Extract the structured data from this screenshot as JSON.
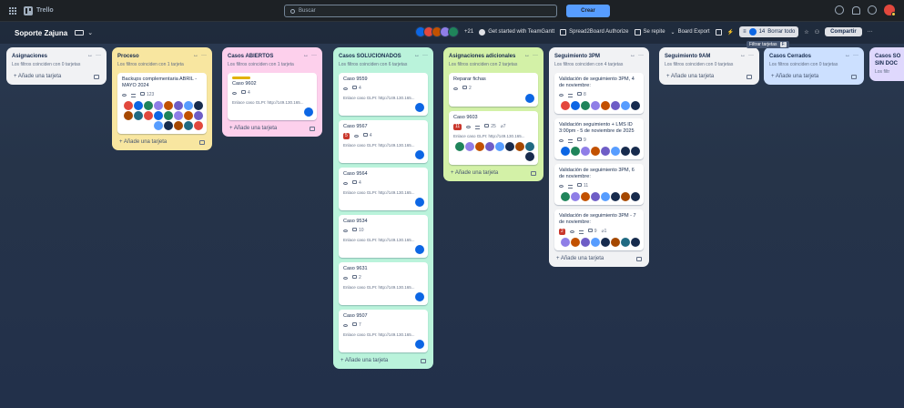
{
  "topbar": {
    "app_name": "Trello",
    "search_placeholder": "Buscar",
    "create_label": "Crear"
  },
  "board": {
    "name": "Soporte Zajuna",
    "members_extra": "+21",
    "get_started": "Get started with TeamGantt",
    "spread2board": "Spread2Board Authorize",
    "se_repite": "Se repite",
    "board_export": "Board Export",
    "filter_count": "14",
    "clear_all": "Borrar todo",
    "share": "Compartir",
    "filter_tooltip": "Filtrar tarjetas",
    "filter_tooltip_key": "F"
  },
  "add_card_label": "Añade una tarjeta",
  "lists": [
    {
      "title": "Asignaciones",
      "sub": "Los filtros coinciden con 0 tarjetas",
      "color": "#f1f2f4",
      "cards": []
    },
    {
      "title": "Proceso",
      "sub": "Los filtros coinciden con 1 tarjeta",
      "color": "#f8e6a0",
      "cards": [
        {
          "title": "Backups complementaria ABRIL - MAYO 2024",
          "comments": "123"
        }
      ]
    },
    {
      "title": "Casos ABIERTOS",
      "sub": "Los filtros coinciden con 1 tarjeta",
      "color": "#fdd0ec",
      "cards": [
        {
          "title": "Caso 9602",
          "comments": "4",
          "desc": "Enlace caso GLPI: http://149.130.165..."
        }
      ]
    },
    {
      "title": "Casos SOLUCIONADOS",
      "sub": "Los filtros coinciden con 6 tarjetas",
      "color": "#baf3db",
      "cards": [
        {
          "title": "Caso 9559",
          "comments": "4",
          "desc": "Enlace caso GLPI: http://149.130.165..."
        },
        {
          "title": "Caso 9567",
          "badge": "5",
          "comments": "4",
          "desc": "Enlace caso GLPI: http://149.130.165..."
        },
        {
          "title": "Caso 9564",
          "comments": "4",
          "desc": "Enlace caso GLPI: http://149.130.165..."
        },
        {
          "title": "Caso 9534",
          "comments": "10",
          "desc": "Enlace caso GLPI: http://149.130.165..."
        },
        {
          "title": "Caso 9631",
          "comments": "2",
          "desc": "Enlace caso GLPI: http://149.130.165..."
        },
        {
          "title": "Caso 9507",
          "comments": "7",
          "desc": "Enlace caso GLPI: http://149.130.165..."
        }
      ]
    },
    {
      "title": "Asignaciones adicionales",
      "sub": "Los filtros coinciden con 2 tarjetas",
      "color": "#d3f1a7",
      "cards": [
        {
          "title": "Reparar fichas",
          "comments": "2"
        },
        {
          "title": "Caso 9603",
          "badge": "11",
          "comments": "25",
          "attach": "7",
          "desc": "Enlace caso GLPI: http://149.130.165..."
        }
      ]
    },
    {
      "title": "Seguimiento 3PM",
      "sub": "Los filtros coinciden con 4 tarjetas",
      "color": "#f1f2f4",
      "cards": [
        {
          "title": "Validación de seguimiento 3PM, 4 de noviembre:",
          "comments": "8"
        },
        {
          "title": "Validación seguimiento + LMS ID 3:00pm - 5 de noviembre de 2025",
          "comments": "9"
        },
        {
          "title": "Validación de seguimiento 3PM, 6 de noviembre:",
          "comments": "11"
        },
        {
          "title": "Validación de seguimiento 3PM - 7 de noviembre:",
          "badge": "2",
          "comments": "9",
          "attach": "1"
        }
      ]
    },
    {
      "title": "Seguimiento 9AM",
      "sub": "Los filtros coinciden con 0 tarjetas",
      "color": "#f1f2f4",
      "cards": []
    },
    {
      "title": "Casos Cerrados",
      "sub": "Los filtros coinciden con 0 tarjetas",
      "color": "#cce0ff",
      "cards": []
    },
    {
      "title": "Casos SO SIN DOC",
      "sub": "Los filtr",
      "color": "#dfd8fd",
      "cards": []
    }
  ],
  "colors": {
    "avatar_palette": [
      "#e2483d",
      "#0c66e4",
      "#1f845a",
      "#8f7ee7",
      "#c25100",
      "#6e5dc6",
      "#579dff",
      "#172b4d",
      "#a54800",
      "#206a83"
    ]
  }
}
